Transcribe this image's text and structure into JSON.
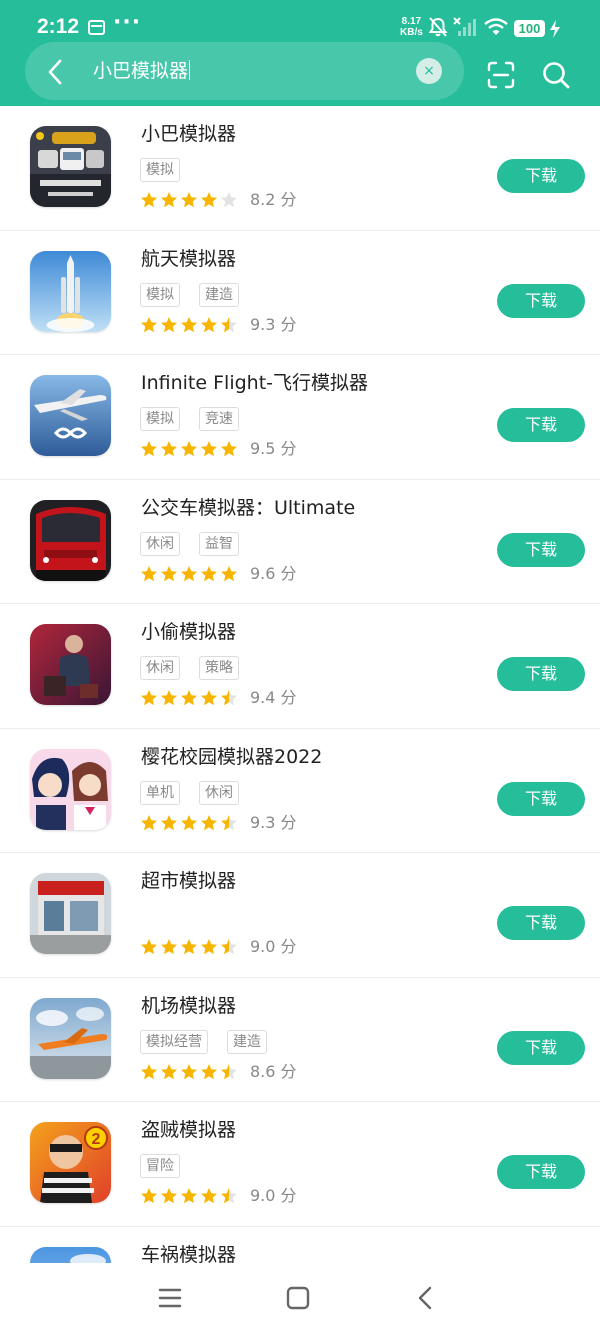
{
  "status": {
    "time": "2:12",
    "dots": "···",
    "net_speed_value": "8.17",
    "net_speed_unit": "KB/s",
    "battery": "100"
  },
  "search": {
    "query": "小巴模拟器",
    "clear_glyph": "×"
  },
  "colors": {
    "accent": "#25bd9a",
    "star_filled": "#f7b500",
    "star_empty": "#e3e3e3"
  },
  "apps": [
    {
      "name": "小巴模拟器",
      "tags": [
        "模拟"
      ],
      "stars": 4,
      "score": "8.2 分",
      "button": "下载",
      "icon": "minibus-simulator-icon"
    },
    {
      "name": "航天模拟器",
      "tags": [
        "模拟",
        "建造"
      ],
      "stars": 4.5,
      "score": "9.3 分",
      "button": "下载",
      "icon": "rocket-icon"
    },
    {
      "name": "Infinite Flight-飞行模拟器",
      "tags": [
        "模拟",
        "竞速"
      ],
      "stars": 5,
      "score": "9.5 分",
      "button": "下载",
      "icon": "airplane-icon"
    },
    {
      "name": "公交车模拟器：Ultimate",
      "tags": [
        "休闲",
        "益智"
      ],
      "stars": 5,
      "score": "9.6 分",
      "button": "下载",
      "icon": "red-bus-icon"
    },
    {
      "name": "小偷模拟器",
      "tags": [
        "休闲",
        "策略"
      ],
      "stars": 4.5,
      "score": "9.4 分",
      "button": "下载",
      "icon": "thief-character-icon"
    },
    {
      "name": "樱花校园模拟器2022",
      "tags": [
        "单机",
        "休闲"
      ],
      "stars": 4.5,
      "score": "9.3 分",
      "button": "下载",
      "icon": "anime-girls-icon"
    },
    {
      "name": "超市模拟器",
      "tags": [],
      "stars": 4.5,
      "score": "9.0 分",
      "button": "下载",
      "icon": "supermarket-icon"
    },
    {
      "name": "机场模拟器",
      "tags": [
        "模拟经营",
        "建造"
      ],
      "stars": 4.5,
      "score": "8.6 分",
      "button": "下载",
      "icon": "airport-plane-icon"
    },
    {
      "name": "盗贼模拟器",
      "tags": [
        "冒险"
      ],
      "stars": 4.5,
      "score": "9.0 分",
      "button": "下载",
      "icon": "robber-icon"
    },
    {
      "name": "车祸模拟器",
      "tags": [],
      "stars": 0,
      "score": "",
      "button": "",
      "icon": "sky-icon"
    }
  ],
  "navbar": {
    "items": [
      "menu-icon",
      "home-icon",
      "back-icon"
    ]
  }
}
